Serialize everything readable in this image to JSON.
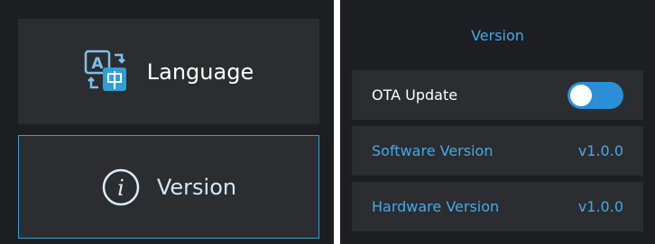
{
  "left_menu": {
    "items": [
      {
        "label": "Language",
        "icon": "translate-icon",
        "selected": false
      },
      {
        "label": "Version",
        "icon": "info-icon",
        "selected": true
      }
    ]
  },
  "version_panel": {
    "title": "Version",
    "ota_update": {
      "label": "OTA Update",
      "enabled": true
    },
    "software": {
      "label": "Software Version",
      "value": "v1.0.0"
    },
    "hardware": {
      "label": "Hardware Version",
      "value": "v1.0.0"
    }
  },
  "colors": {
    "accent": "#45a9e6",
    "toggle_on": "#2b8fd8",
    "panel_bg": "#1c1e22",
    "item_bg": "#2b2d31"
  }
}
